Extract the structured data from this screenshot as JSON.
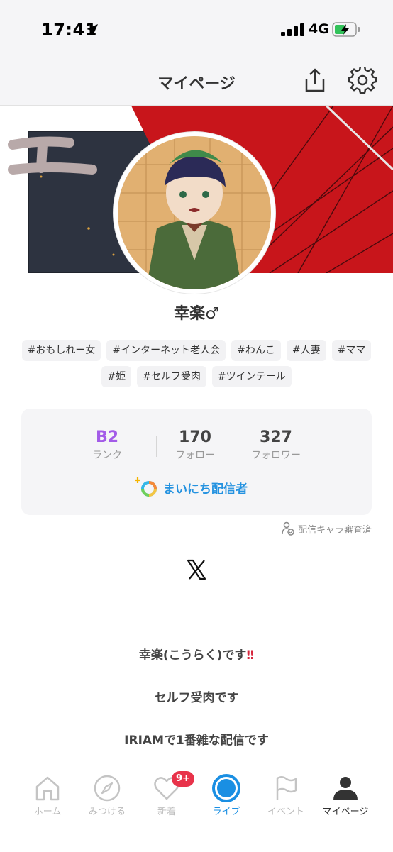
{
  "status_bar": {
    "time": "17:41",
    "network": "4G"
  },
  "header": {
    "title": "マイページ"
  },
  "profile": {
    "name": "幸楽♂",
    "tags_row1": [
      "#おもしれー女",
      "#インターネット老人会",
      "#わんこ",
      "#人妻",
      "#ママ"
    ],
    "tags_row2": [
      "#姫",
      "#セルフ受肉",
      "#ツインテール"
    ]
  },
  "stats": {
    "rank_value": "B2",
    "rank_label": "ランク",
    "follow_value": "170",
    "follow_label": "フォロー",
    "follower_value": "327",
    "follower_label": "フォロワー",
    "daily_label": "まいにち配信者"
  },
  "review_label": "配信キャラ審査済",
  "bio": {
    "line1": "幸楽(こうらく)です",
    "line1_mark": "‼",
    "line2": "セルフ受肉です",
    "line3": "IRIAMで1番雑な配信です"
  },
  "nav": {
    "badge": "9+",
    "items": [
      "ホーム",
      "みつける",
      "新着",
      "ライブ",
      "イベント",
      "マイページ"
    ]
  },
  "colors": {
    "accent_blue": "#1a8fe3",
    "rank_purple": "#a35be8",
    "badge_red": "#e8334a"
  }
}
